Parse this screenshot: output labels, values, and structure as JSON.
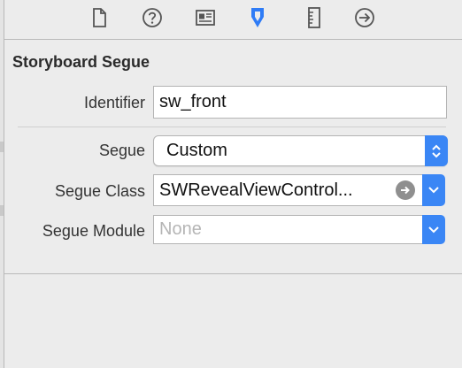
{
  "toolbar": {
    "icons": [
      "file-inspector-icon",
      "quick-help-icon",
      "identity-inspector-icon",
      "attributes-inspector-icon",
      "size-inspector-icon",
      "connections-inspector-icon"
    ],
    "accent": "#2f7cf6",
    "icon_color": "#555555"
  },
  "section": {
    "title": "Storyboard Segue"
  },
  "identifier": {
    "label": "Identifier",
    "value": "sw_front"
  },
  "segue": {
    "label": "Segue",
    "value": "Custom"
  },
  "segue_class": {
    "label": "Segue Class",
    "value": "SWRevealViewControl..."
  },
  "segue_module": {
    "label": "Segue Module",
    "placeholder": "None"
  }
}
